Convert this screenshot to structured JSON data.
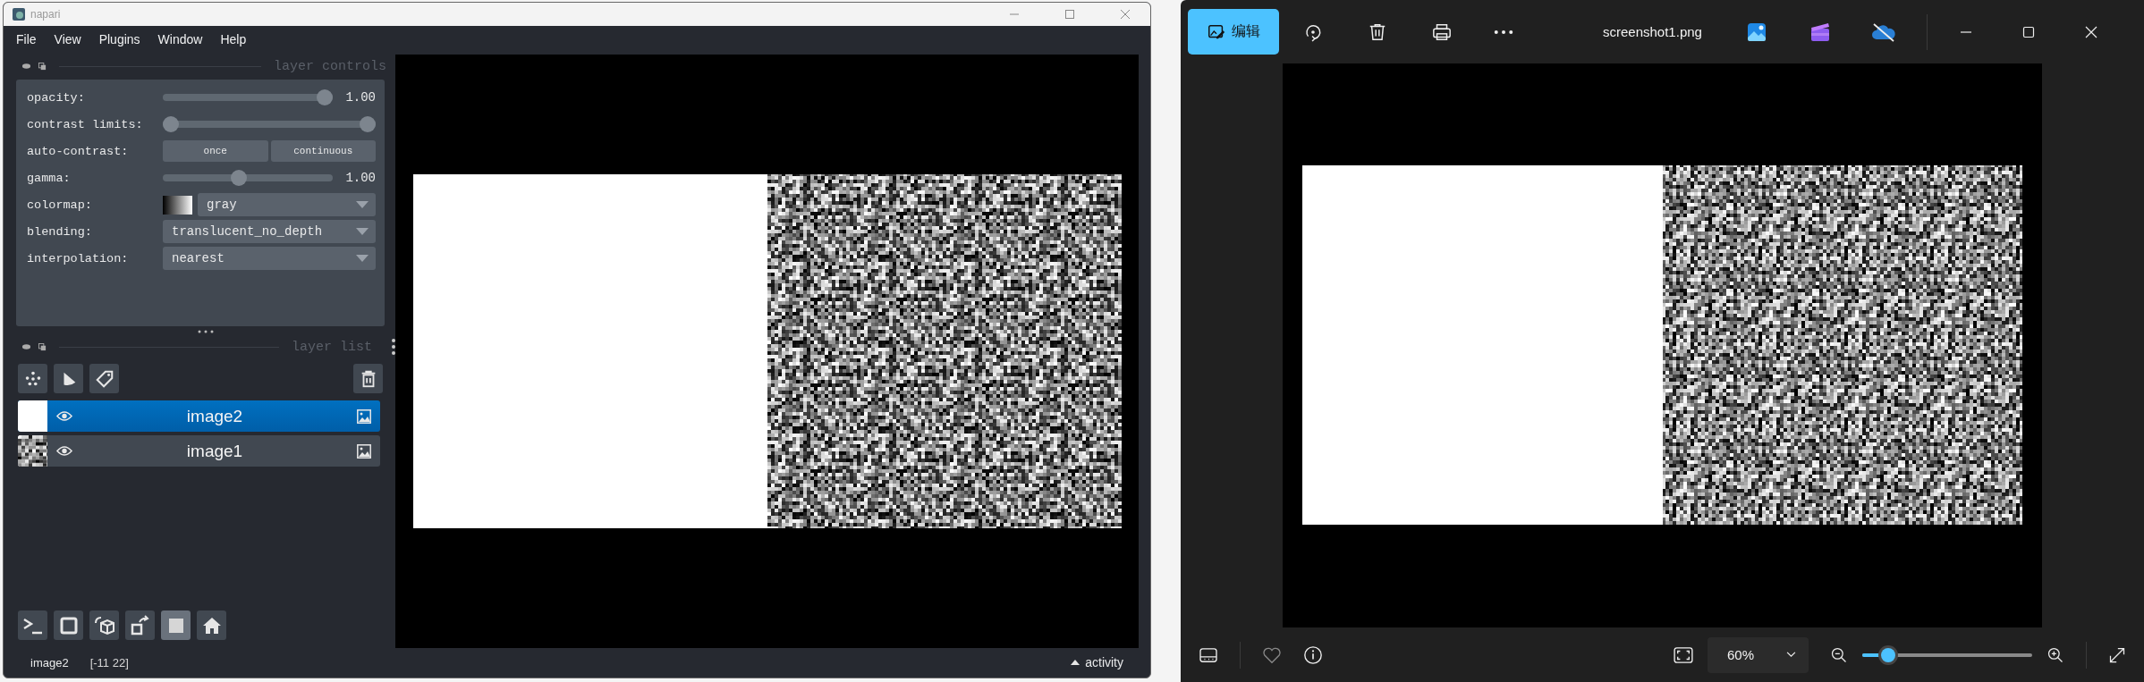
{
  "napari": {
    "title": "napari",
    "menu": [
      "File",
      "View",
      "Plugins",
      "Window",
      "Help"
    ],
    "layer_controls": {
      "title": "layer controls",
      "rows": [
        {
          "kind": "slider",
          "label": "opacity:",
          "level": 1,
          "reading": "1.00"
        },
        {
          "kind": "range",
          "label": "contrast limits:",
          "thumbs": [
            {
              "level": 0
            },
            {
              "level": 1
            }
          ]
        },
        {
          "kind": "buttons",
          "label": "auto-contrast:",
          "buttons": [
            "once",
            "continuous"
          ]
        },
        {
          "kind": "slider",
          "label": "gamma:",
          "level": 0.44,
          "reading": "1.00"
        },
        {
          "kind": "colormap",
          "label": "colormap:",
          "value": "gray"
        },
        {
          "kind": "dropdown",
          "label": "blending:",
          "value": "translucent_no_depth"
        },
        {
          "kind": "dropdown",
          "label": "interpolation:",
          "value": "nearest"
        }
      ]
    },
    "layer_list": {
      "title": "layer list",
      "layers": [
        {
          "name": "image2",
          "selected": true,
          "visible": true,
          "kind": "plain"
        },
        {
          "name": "image1",
          "selected": false,
          "visible": true,
          "kind": "noise"
        }
      ]
    },
    "viewer_buttons": [
      {
        "kind": "console",
        "on": false
      },
      {
        "kind": "ndisplay",
        "on": false
      },
      {
        "kind": "roll",
        "on": false
      },
      {
        "kind": "transpose",
        "on": false
      },
      {
        "kind": "grid",
        "on": true
      },
      {
        "kind": "home",
        "on": false
      }
    ],
    "status_bar": {
      "layer": "image2",
      "position": "[-11 22]",
      "activity": "activity"
    }
  },
  "photos": {
    "edit_button": "编辑",
    "filename": "screenshot1.png",
    "zoom": {
      "value": "60%",
      "level": 0.12
    }
  }
}
